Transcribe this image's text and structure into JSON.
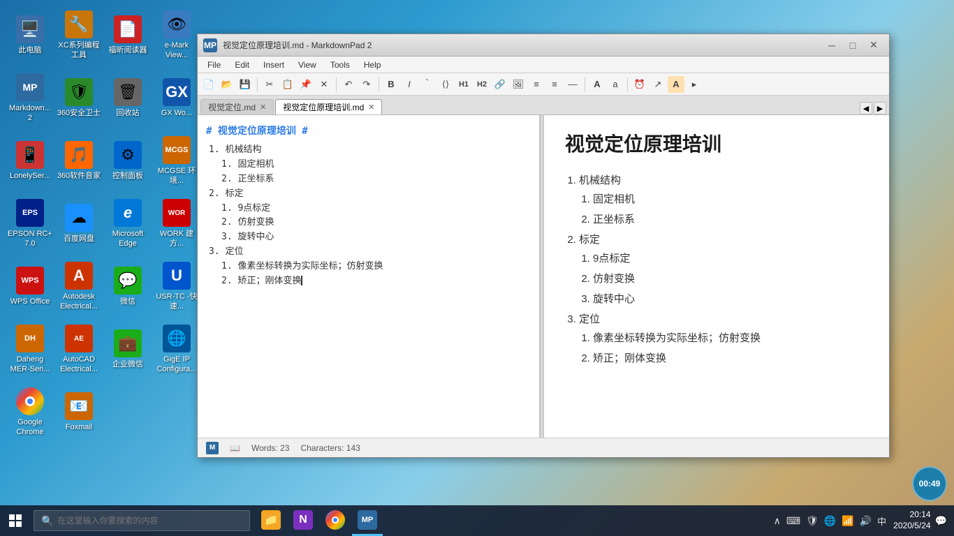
{
  "desktop": {
    "background_desc": "ocean beach sunset gradient"
  },
  "desktop_icons": [
    {
      "id": "computer",
      "label": "此电脑",
      "emoji": "🖥️",
      "color": "#4a90d9"
    },
    {
      "id": "xc-tools",
      "label": "XC系列编程工具",
      "emoji": "🔧",
      "color": "#e07b00"
    },
    {
      "id": "pdf-reader",
      "label": "福昕阅读器",
      "emoji": "📄",
      "color": "#e04040"
    },
    {
      "id": "emarkview",
      "label": "e-Mark View...",
      "emoji": "👁",
      "color": "#3a7abf"
    },
    {
      "id": "markdownpad",
      "label": "Markdown... 2",
      "emoji": "✎",
      "color": "#2d6a9f"
    },
    {
      "id": "security-guard",
      "label": "360安全卫士",
      "emoji": "🛡",
      "color": "#3aaa3a"
    },
    {
      "id": "recycle",
      "label": "回收站",
      "emoji": "🗑",
      "color": "#777"
    },
    {
      "id": "gx-word",
      "label": "GX Wo...",
      "emoji": "W",
      "color": "#1155aa"
    },
    {
      "id": "lonelyscreen",
      "label": "LonelySer...",
      "emoji": "📱",
      "color": "#e05050"
    },
    {
      "id": "360-music",
      "label": "360软件音家",
      "emoji": "🎵",
      "color": "#ff6600"
    },
    {
      "id": "control-panel",
      "label": "控制面板",
      "emoji": "⚙",
      "color": "#0066cc"
    },
    {
      "id": "mcgse",
      "label": "MCGSE 环境...",
      "emoji": "M",
      "color": "#cc6600"
    },
    {
      "id": "epson",
      "label": "EPSON RC+ 7.0",
      "emoji": "E",
      "color": "#003399"
    },
    {
      "id": "baidu-disk",
      "label": "百度网盘",
      "emoji": "☁",
      "color": "#1890ff"
    },
    {
      "id": "edge",
      "label": "Microsoft Edge",
      "emoji": "e",
      "color": "#0078d7"
    },
    {
      "id": "work",
      "label": "WORK 建方...",
      "emoji": "W",
      "color": "#cc0000"
    },
    {
      "id": "wps",
      "label": "WPS Office",
      "emoji": "W",
      "color": "#cc1111"
    },
    {
      "id": "autodesk",
      "label": "Autodesk Electrical...",
      "emoji": "A",
      "color": "#cc3300"
    },
    {
      "id": "wechat",
      "label": "微信",
      "emoji": "💬",
      "color": "#1aad19"
    },
    {
      "id": "usr-tc",
      "label": "USR-TC -快速...",
      "emoji": "U",
      "color": "#0055cc"
    },
    {
      "id": "dahua",
      "label": "Daheng MER-Seri...",
      "emoji": "D",
      "color": "#cc6600"
    },
    {
      "id": "autocad-elec",
      "label": "AutoCAD Electrical...",
      "emoji": "A",
      "color": "#cc3300"
    },
    {
      "id": "qiyeweixin",
      "label": "企业微信",
      "emoji": "💼",
      "color": "#1aad19"
    },
    {
      "id": "gige",
      "label": "GigE IP Configura...",
      "emoji": "🌐",
      "color": "#005599"
    },
    {
      "id": "chrome",
      "label": "Google Chrome",
      "emoji": "◉",
      "color": "#4285f4"
    },
    {
      "id": "foxmail",
      "label": "Foxmail",
      "emoji": "📧",
      "color": "#cc6600"
    }
  ],
  "window": {
    "title": "视觉定位原理培训.md - MarkdownPad 2",
    "icon_letter": "MP",
    "menus": [
      "File",
      "Edit",
      "Insert",
      "View",
      "Tools",
      "Help"
    ]
  },
  "tabs": [
    {
      "id": "tab1",
      "label": "视觉定位.md",
      "active": false,
      "closeable": true
    },
    {
      "id": "tab2",
      "label": "视觉定位原理培训.md",
      "active": true,
      "closeable": true
    }
  ],
  "editor": {
    "heading": "# 视觉定位原理培训 #",
    "lines": [
      {
        "text": "1.  机械结构",
        "indent": 0
      },
      {
        "text": "1.  固定相机",
        "indent": 1
      },
      {
        "text": "2.  正坐标系",
        "indent": 1
      },
      {
        "text": "2.  标定",
        "indent": 0
      },
      {
        "text": "1.  9点标定",
        "indent": 1
      },
      {
        "text": "2.  仿射变换",
        "indent": 1
      },
      {
        "text": "3.  旋转中心",
        "indent": 1
      },
      {
        "text": "3.  定位",
        "indent": 0
      },
      {
        "text": "1.  像素坐标转换为实际坐标；仿射变换",
        "indent": 1
      },
      {
        "text": "2.  矫正；刚体变换",
        "indent": 1,
        "cursor": true
      }
    ]
  },
  "preview": {
    "title": "视觉定位原理培训",
    "sections": [
      {
        "num": "1.",
        "label": "机械结构",
        "items": [
          {
            "num": "1.",
            "label": "固定相机"
          },
          {
            "num": "2.",
            "label": "正坐标系"
          }
        ]
      },
      {
        "num": "2.",
        "label": "标定",
        "items": [
          {
            "num": "1.",
            "label": "9点标定"
          },
          {
            "num": "2.",
            "label": "仿射变换"
          },
          {
            "num": "3.",
            "label": "旋转中心"
          }
        ]
      },
      {
        "num": "3.",
        "label": "定位",
        "items": [
          {
            "num": "1.",
            "label": "像素坐标转换为实际坐标；仿射变换"
          },
          {
            "num": "2.",
            "label": "矫正；刚体变换"
          }
        ]
      }
    ]
  },
  "statusbar": {
    "words_label": "Words:",
    "words_count": "23",
    "chars_label": "Characters:",
    "chars_count": "143"
  },
  "taskbar": {
    "search_placeholder": "在这里输入你要搜索的内容",
    "time": "20:14",
    "date": "2020/5/24",
    "lang": "中",
    "clock_display": "00:49",
    "apps": [
      {
        "id": "file-explorer",
        "emoji": "📁",
        "active": false
      },
      {
        "id": "onenote",
        "emoji": "N",
        "active": false
      },
      {
        "id": "chrome-taskbar",
        "emoji": "◉",
        "active": false
      },
      {
        "id": "markdownpad-taskbar",
        "emoji": "MP",
        "active": true
      }
    ]
  }
}
